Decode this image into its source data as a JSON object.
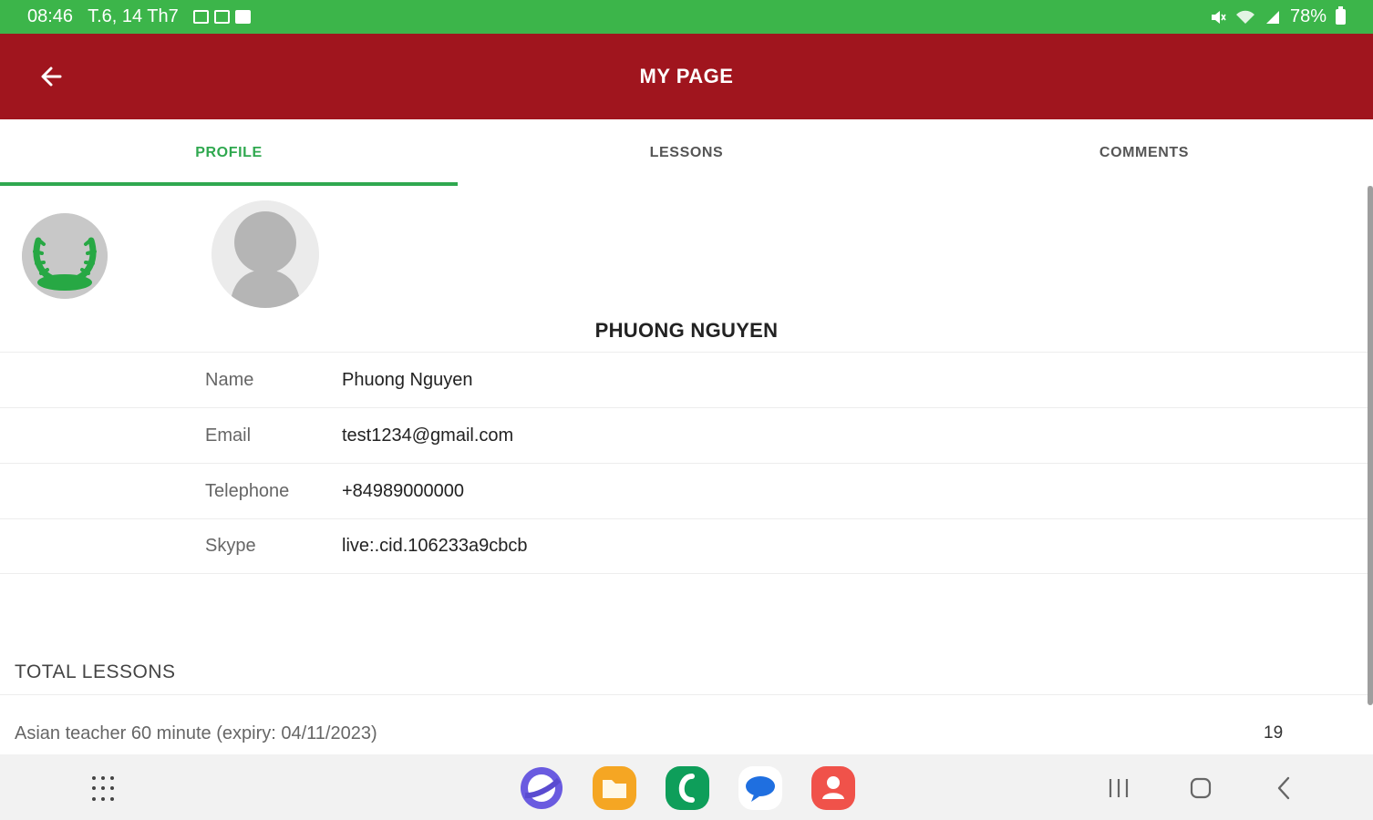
{
  "status_bar": {
    "time": "08:46",
    "date": "T.6, 14 Th7",
    "battery": "78%"
  },
  "app_bar": {
    "title": "MY PAGE"
  },
  "tabs": [
    {
      "label": "PROFILE",
      "active": true
    },
    {
      "label": "LESSONS",
      "active": false
    },
    {
      "label": "COMMENTS",
      "active": false
    }
  ],
  "profile": {
    "display_name": "PHUONG NGUYEN",
    "fields": [
      {
        "label": "Name",
        "value": "Phuong Nguyen"
      },
      {
        "label": "Email",
        "value": "test1234@gmail.com"
      },
      {
        "label": "Telephone",
        "value": "+84989000000"
      },
      {
        "label": "Skype",
        "value": "live:.cid.106233a9cbcb"
      }
    ]
  },
  "total_lessons": {
    "title": "TOTAL LESSONS",
    "items": [
      {
        "name": "Asian teacher 60 minute (expiry: 04/11/2023)",
        "count": "19"
      }
    ]
  },
  "colors": {
    "status_bar": "#3cb54a",
    "app_bar": "#a0151e",
    "accent": "#2fa84f"
  },
  "dock_icons": [
    "samsung-internet-icon",
    "my-files-icon",
    "phone-app-icon",
    "messages-icon",
    "contacts-icon"
  ]
}
